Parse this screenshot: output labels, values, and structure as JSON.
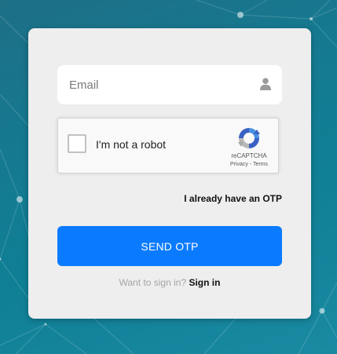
{
  "theme": {
    "primary_button": "#0a7bff",
    "card_background": "#eeeeee",
    "page_background": "#157a91"
  },
  "form": {
    "email": {
      "placeholder": "Email",
      "value": "",
      "icon": "user-icon"
    },
    "recaptcha": {
      "label": "I'm not a robot",
      "brand": "reCAPTCHA",
      "privacy": "Privacy",
      "separator": " - ",
      "terms": "Terms",
      "checked": false
    },
    "otp_link": "I already have an OTP",
    "submit_label": "SEND OTP",
    "signin_prompt": "Want to sign in?",
    "signin_link": "Sign in"
  }
}
